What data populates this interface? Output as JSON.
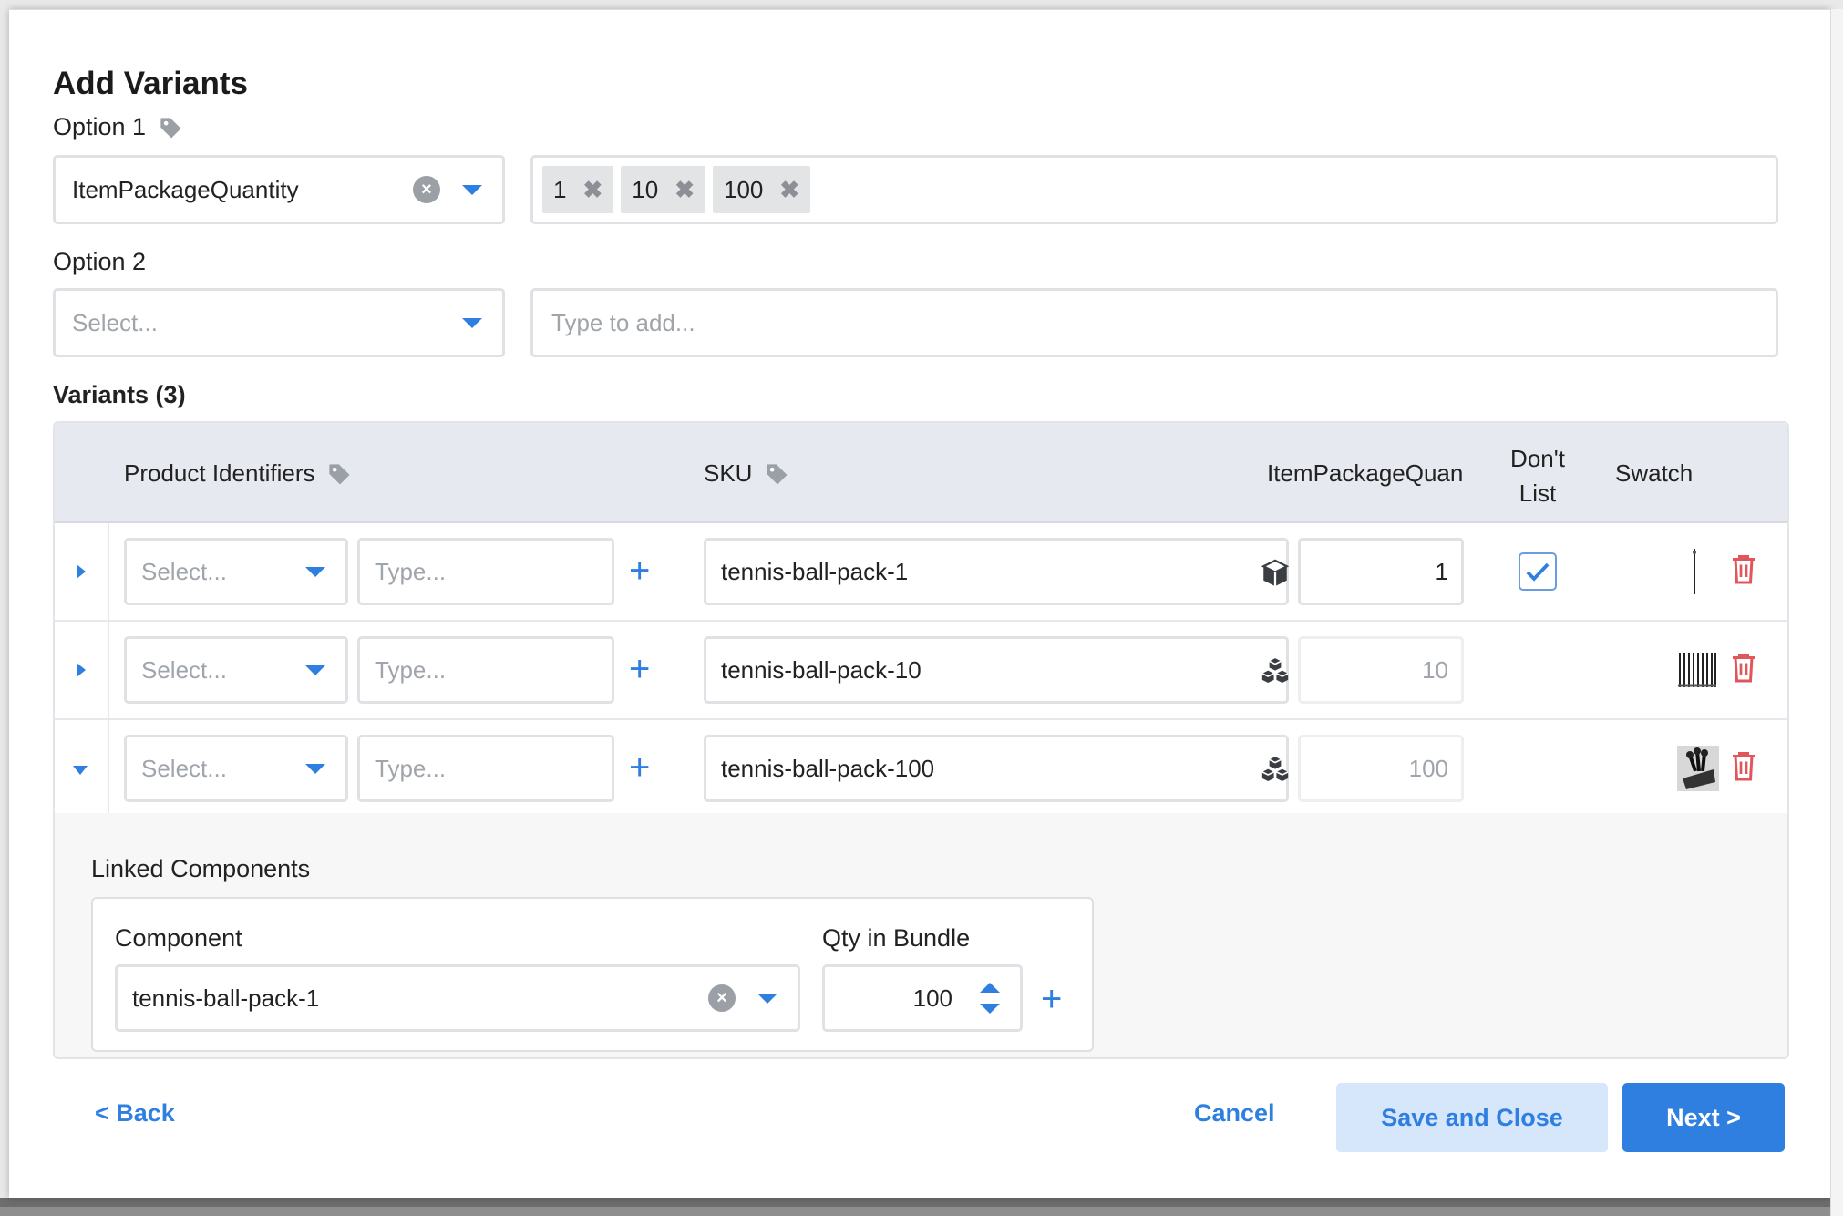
{
  "title": "Add Variants",
  "option1": {
    "label": "Option 1",
    "selected": "ItemPackageQuantity",
    "clear_symbol": "×",
    "values": [
      "1",
      "10",
      "100"
    ],
    "chip_remove_symbol": "✖"
  },
  "option2": {
    "label": "Option 2",
    "select_placeholder": "Select...",
    "values_placeholder": "Type to add..."
  },
  "variants": {
    "heading": "Variants (3)",
    "columns": {
      "product_identifiers": "Product Identifiers",
      "sku": "SKU",
      "item_package_quantity": "ItemPackageQuan",
      "dont_list_line1": "Don't",
      "dont_list_line2": "List",
      "swatch": "Swatch"
    },
    "rows": [
      {
        "id_select_placeholder": "Select...",
        "id_type_placeholder": "Type...",
        "sku": "tennis-ball-pack-1",
        "qty": "1",
        "dont_list_checked": true,
        "expanded": false
      },
      {
        "id_select_placeholder": "Select...",
        "id_type_placeholder": "Type...",
        "sku": "tennis-ball-pack-10",
        "qty": "10",
        "dont_list_checked": false,
        "expanded": false
      },
      {
        "id_select_placeholder": "Select...",
        "id_type_placeholder": "Type...",
        "sku": "tennis-ball-pack-100",
        "qty": "100",
        "dont_list_checked": false,
        "expanded": true
      }
    ],
    "plus_symbol": "+"
  },
  "linked_components": {
    "heading": "Linked Components",
    "component_label": "Component",
    "qty_label": "Qty in Bundle",
    "component_value": "tennis-ball-pack-1",
    "qty_value": "100",
    "plus_symbol": "+"
  },
  "footer": {
    "back": "< Back",
    "cancel": "Cancel",
    "save_close": "Save and Close",
    "next": "Next >"
  },
  "colors": {
    "accent": "#2f7fe0",
    "danger": "#e0565b",
    "header_bg": "#e6eaf0"
  },
  "icons": [
    "tag-icon",
    "close-icon",
    "chevron-down-icon",
    "caret-right-icon",
    "plus-icon",
    "cube-icon",
    "cubes-icon",
    "checkmark-icon",
    "trash-icon",
    "arrow-up-icon",
    "arrow-down-icon"
  ]
}
